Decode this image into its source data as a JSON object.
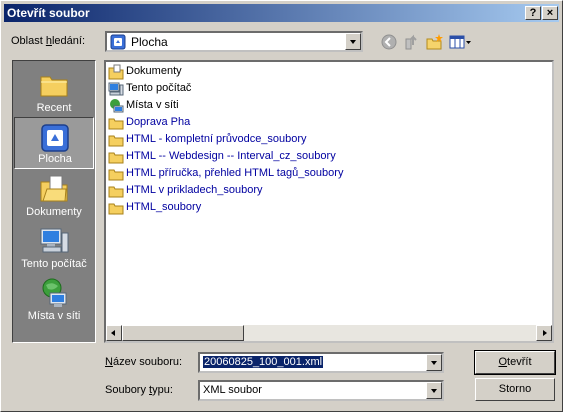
{
  "window": {
    "title": "Otevřít soubor",
    "help_label": "?",
    "close_label": "×"
  },
  "lookin": {
    "label_pre": "Oblast ",
    "label_ul": "h",
    "label_post": "ledání:",
    "value": "Plocha"
  },
  "toolbar": {
    "icons": [
      "back-icon",
      "up-folder-icon",
      "new-folder-icon",
      "view-menu-icon"
    ]
  },
  "places": [
    {
      "label": "Recent",
      "icon": "recent-folder-icon"
    },
    {
      "label": "Plocha",
      "icon": "desktop-icon"
    },
    {
      "label": "Dokumenty",
      "icon": "documents-icon"
    },
    {
      "label": "Tento počítač",
      "icon": "computer-icon"
    },
    {
      "label": "Místa v síti",
      "icon": "network-icon"
    }
  ],
  "files": [
    {
      "name": "Dokumenty",
      "icon": "documents-icon",
      "type": "system"
    },
    {
      "name": "Tento počítač",
      "icon": "computer-icon",
      "type": "system"
    },
    {
      "name": "Místa v síti",
      "icon": "network-icon",
      "type": "system"
    },
    {
      "name": "Doprava Pha",
      "icon": "folder-icon",
      "type": "folder"
    },
    {
      "name": "HTML - kompletní průvodce_soubory",
      "icon": "folder-icon",
      "type": "folder"
    },
    {
      "name": "HTML -- Webdesign -- Interval_cz_soubory",
      "icon": "folder-icon",
      "type": "folder"
    },
    {
      "name": "HTML příručka, přehled HTML tagů_soubory",
      "icon": "folder-icon",
      "type": "folder"
    },
    {
      "name": "HTML v prikladech_soubory",
      "icon": "folder-icon",
      "type": "folder"
    },
    {
      "name": "HTML_soubory",
      "icon": "folder-icon",
      "type": "folder"
    }
  ],
  "filename": {
    "label_ul": "N",
    "label_post": "ázev souboru:",
    "value": "20060825_100_001.xml"
  },
  "filetype": {
    "label_pre": "Soubory ",
    "label_ul": "t",
    "label_post": "ypu:",
    "value": "XML soubor"
  },
  "buttons": {
    "open_pre": "",
    "open_ul": "O",
    "open_post": "tevřít",
    "cancel": "Storno"
  },
  "colors": {
    "titlebar_start": "#0a246a",
    "titlebar_end": "#a6caf0",
    "folder_text": "#0000a0",
    "dialog_bg": "#d4d0c8"
  }
}
